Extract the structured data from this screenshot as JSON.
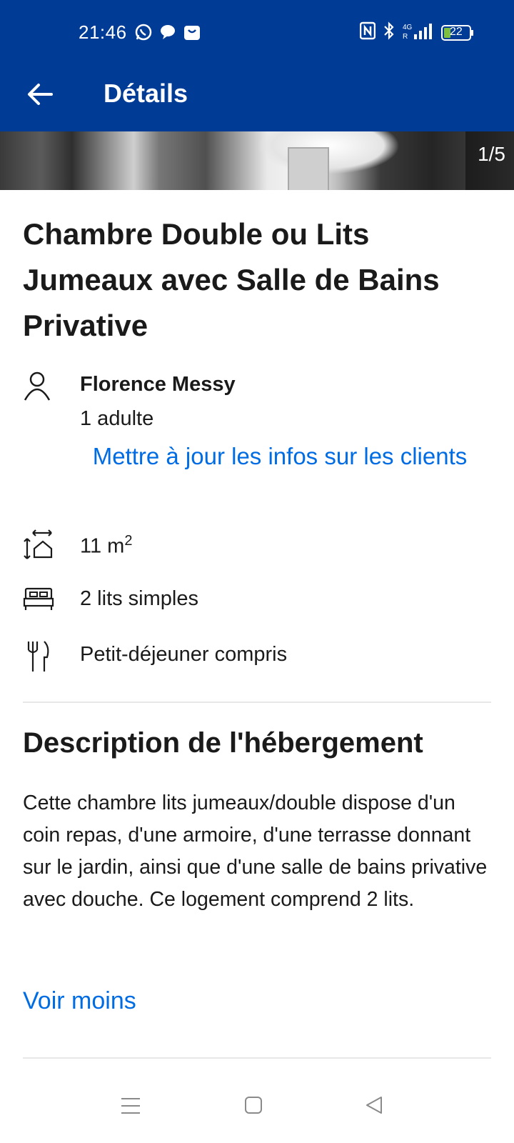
{
  "status_bar": {
    "time": "21:46",
    "battery": "22",
    "left_icons": [
      "whatsapp-icon",
      "chat-bubble-icon",
      "shopping-bag-icon"
    ],
    "right_icons": [
      "nfc-icon",
      "bluetooth-icon",
      "signal-4g-icon",
      "battery-icon"
    ]
  },
  "app_bar": {
    "title": "Détails",
    "back_icon": "arrow-left-icon"
  },
  "gallery": {
    "counter": "1/5"
  },
  "room": {
    "title": "Chambre Double ou Lits Jumeaux avec Salle de Bains Privative"
  },
  "guest": {
    "name": "Florence Messy",
    "occupancy": "1 adulte",
    "update_link": "Mettre à jour les infos sur les clients"
  },
  "features": {
    "size_value": "11 m",
    "size_exponent": "2",
    "beds": "2 lits simples",
    "meal": "Petit-déjeuner compris"
  },
  "description": {
    "heading": "Description de l'hébergement",
    "text": "Cette chambre lits jumeaux/double dispose d'un coin repas, d'une armoire, d'une terrasse donnant sur le jardin, ainsi que d'une salle de bains privative avec douche. Ce logement comprend 2 lits.",
    "toggle": "Voir moins"
  },
  "colors": {
    "brand": "#003b95",
    "link": "#006ce4",
    "text": "#1a1a1a"
  },
  "nav_bar": {
    "buttons": [
      "menu-icon",
      "home-square-icon",
      "back-triangle-icon"
    ]
  }
}
